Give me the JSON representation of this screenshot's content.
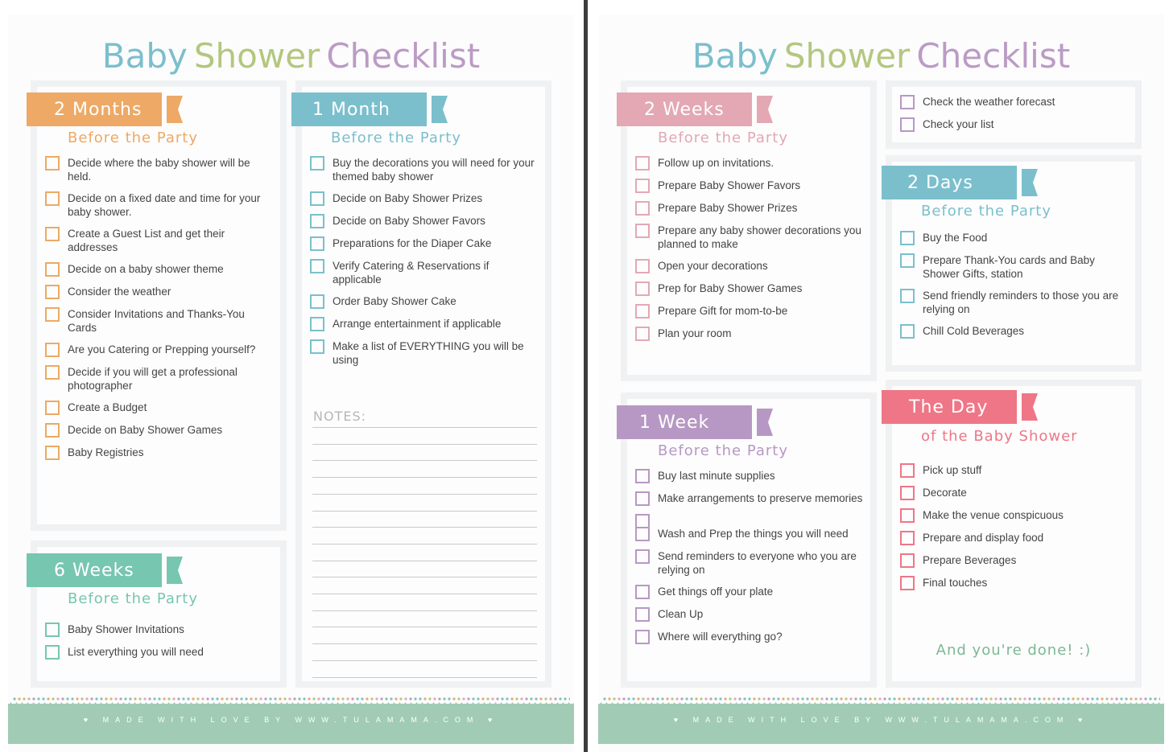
{
  "colors": {
    "blue": "#7bbfcd",
    "green": "#b3c77f",
    "purple": "#bb9bc6",
    "orange": "#eda965",
    "teal": "#77c6b0",
    "pink": "#e3a8b4",
    "lilac": "#b798c4",
    "coral": "#ef7687",
    "done_green": "#7cb894",
    "footer_green": "#a1cbb5"
  },
  "pages": [
    {
      "title": {
        "word1": "Baby",
        "word2": "Shower",
        "word3": "Checklist"
      },
      "sections": [
        {
          "id": "2-months",
          "heading": "2 Months",
          "subheading": "Before the Party",
          "items": [
            "Decide where the baby shower will be held.",
            "Decide on a fixed date and time for your baby shower.",
            "Create a Guest List and get their addresses",
            "Decide on a baby shower theme",
            "Consider the weather",
            "Consider Invitations and Thanks-You Cards",
            "Are you Catering or Prepping yourself?",
            "Decide if you will get a professional photographer",
            "Create a Budget",
            "Decide on Baby Shower Games",
            "Baby Registries"
          ]
        },
        {
          "id": "6-weeks",
          "heading": "6 Weeks",
          "subheading": "Before the Party",
          "items": [
            "Baby Shower Invitations",
            "List everything you will need"
          ]
        },
        {
          "id": "1-month",
          "heading": "1 Month",
          "subheading": "Before the Party",
          "items": [
            "Buy the decorations you will need for your themed baby shower",
            "Decide on Baby Shower Prizes",
            "Decide on Baby Shower Favors",
            "Preparations for the Diaper Cake",
            "Verify Catering & Reservations if applicable",
            "Order Baby Shower Cake",
            "Arrange entertainment if applicable",
            "Make a list of EVERYTHING you will be using"
          ],
          "notes_label": "NOTES:"
        }
      ],
      "footer": "♥ MADE WITH LOVE BY WWW.TULAMAMA.COM ♥"
    },
    {
      "title": {
        "word1": "Baby",
        "word2": "Shower",
        "word3": "Checklist"
      },
      "sections": [
        {
          "id": "2-weeks",
          "heading": "2 Weeks",
          "subheading": "Before the Party",
          "items": [
            "Follow up on invitations.",
            "Prepare Baby Shower Favors",
            "Prepare Baby Shower Prizes",
            "Prepare any baby shower decorations you planned to make",
            "Open your decorations",
            "Prep for Baby Shower Games",
            "Prepare Gift for mom-to-be",
            "Plan your room"
          ]
        },
        {
          "id": "1-week",
          "heading": "1 Week",
          "subheading": "Before the Party",
          "items": [
            "Buy last minute supplies",
            "Make arrangements to preserve memories",
            "",
            "Wash and Prep the things you will need",
            "Send reminders to everyone who you are relying on",
            "Get things off your plate",
            "Clean Up",
            "Where will everything go?"
          ]
        },
        {
          "id": "1-week-continued",
          "items": [
            "Check the weather forecast",
            "Check your list"
          ]
        },
        {
          "id": "2-days",
          "heading": "2 Days",
          "subheading": "Before the Party",
          "items": [
            "Buy the Food",
            "Prepare Thank-You cards and Baby Shower Gifts, station",
            "Send friendly reminders to those you are relying on",
            "Chill Cold Beverages"
          ]
        },
        {
          "id": "the-day",
          "heading": "The Day",
          "subheading": "of the Baby Shower",
          "items": [
            "Pick up stuff",
            "Decorate",
            "Make the venue conspicuous",
            "Prepare and display food",
            "Prepare Beverages",
            "Final touches"
          ],
          "closing": "And you're done! :)"
        }
      ],
      "footer": "♥ MADE WITH LOVE BY WWW.TULAMAMA.COM ♥"
    }
  ]
}
